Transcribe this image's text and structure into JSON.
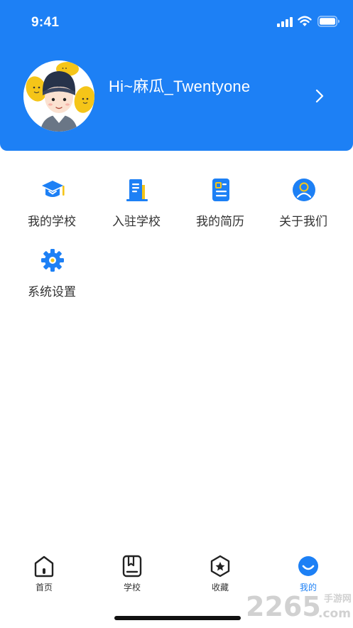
{
  "status_bar": {
    "time": "9:41"
  },
  "profile": {
    "greeting": "Hi~麻瓜_Twentyone"
  },
  "menu": {
    "items": [
      {
        "label": "我的学校",
        "icon": "graduation-cap-icon"
      },
      {
        "label": "入驻学校",
        "icon": "building-icon"
      },
      {
        "label": "我的简历",
        "icon": "resume-icon"
      },
      {
        "label": "关于我们",
        "icon": "user-circle-icon"
      },
      {
        "label": "系统设置",
        "icon": "gear-icon"
      }
    ]
  },
  "tabbar": {
    "items": [
      {
        "label": "首页",
        "icon": "home-icon"
      },
      {
        "label": "学校",
        "icon": "book-icon"
      },
      {
        "label": "收藏",
        "icon": "star-hexagon-icon"
      },
      {
        "label": "我的",
        "icon": "smile-icon",
        "active": true
      }
    ]
  },
  "watermark": {
    "text": "2265",
    "sub_text": "手游网",
    "domain": ".com"
  },
  "colors": {
    "primary": "#1d80f5",
    "accent_yellow": "#f5c518",
    "text_dark": "#333333"
  }
}
